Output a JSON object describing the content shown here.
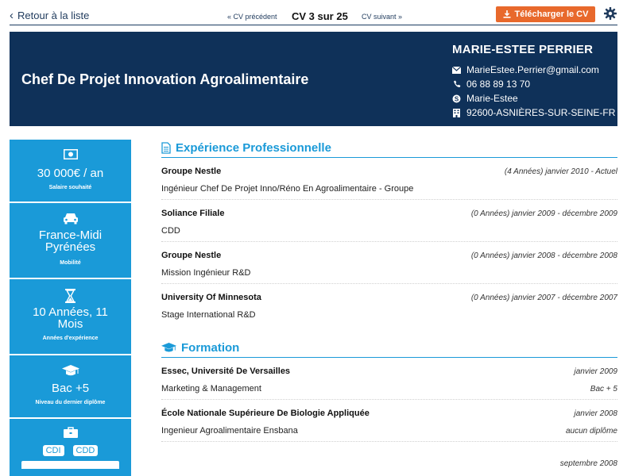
{
  "nav": {
    "back_label": "Retour à la liste",
    "prev_label": "« CV précédent",
    "counter": "CV 3 sur 25",
    "next_label": "CV suivant »",
    "download_label": "Télécharger le CV"
  },
  "header": {
    "job_title": "Chef De Projet Innovation Agroalimentaire",
    "name": "MARIE-ESTEE PERRIER",
    "email": "MarieEstee.Perrier@gmail.com",
    "phone": "06 88 89 13 70",
    "skype": "Marie-Estee",
    "address": "92600-ASNIÈRES-SUR-SEINE-FR"
  },
  "sidebar": {
    "salary": {
      "value": "30 000€ / an",
      "label": "Salaire souhaité",
      "icon": "money-icon"
    },
    "mobility": {
      "value": "France-Midi Pyrénées",
      "label": "Mobilité",
      "icon": "car-icon"
    },
    "experience": {
      "value": "10 Années, 11 Mois",
      "label": "Années d'expérience",
      "icon": "hourglass-icon"
    },
    "degree": {
      "value": "Bac +5",
      "label": "Niveau du dernier diplôme",
      "icon": "graduation-cap-icon"
    },
    "contracts": {
      "tags": [
        "CDI",
        "CDD"
      ],
      "icon": "briefcase-icon"
    }
  },
  "experience": {
    "title": "Expérience Professionnelle",
    "items": [
      {
        "org": "Groupe Nestle",
        "date": "(4 Années) janvier 2010 - Actuel",
        "desc": "Ingénieur Chef De Projet Inno/Réno En Agroalimentaire - Groupe"
      },
      {
        "org": "Soliance Filiale",
        "date": "(0 Années) janvier 2009 - décembre 2009",
        "desc": "CDD"
      },
      {
        "org": "Groupe Nestle",
        "date": "(0 Années) janvier 2008 - décembre 2008",
        "desc": "Mission Ingénieur R&D"
      },
      {
        "org": "University Of Minnesota",
        "date": "(0 Années) janvier 2007 - décembre 2007",
        "desc": "Stage International R&D"
      }
    ]
  },
  "formation": {
    "title": "Formation",
    "items": [
      {
        "org": "Essec, Université De Versailles",
        "date": "janvier 2009",
        "desc": "Marketing & Management",
        "level": "Bac + 5"
      },
      {
        "org": "École Nationale Supérieure De Biologie Appliquée",
        "date": "janvier 2008",
        "desc": "Ingenieur Agroalimentaire Ensbana",
        "level": "aucun diplôme"
      },
      {
        "org": "",
        "date": "septembre 2008",
        "desc": "",
        "level": ""
      }
    ]
  },
  "colors": {
    "navy": "#0f3159",
    "accent_blue": "#1a9ad8",
    "orange": "#e8692c"
  }
}
